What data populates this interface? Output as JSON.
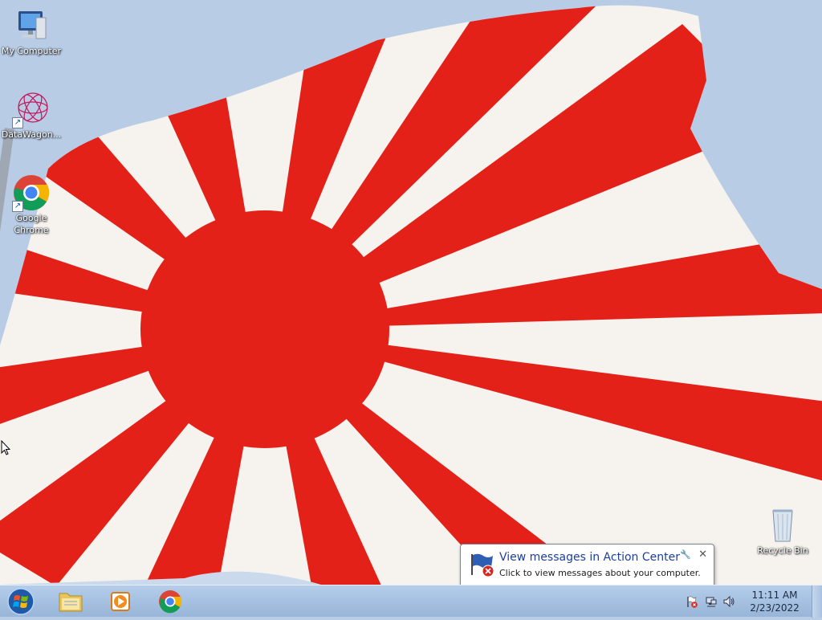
{
  "desktop": {
    "icons": [
      {
        "label": "My Computer",
        "icon": "computer-icon"
      },
      {
        "label": "DataWagon...",
        "icon": "datawagon-icon"
      },
      {
        "label": "Google Chrome",
        "icon": "chrome-icon"
      },
      {
        "label": "Recycle Bin",
        "icon": "recycle-bin-icon"
      }
    ],
    "wallpaper": "rising-sun-flag",
    "colors": {
      "red": "#e32119",
      "white": "#f6f3ef",
      "sky": "#b8cce6"
    }
  },
  "taskbar": {
    "pinned": [
      {
        "name": "Windows Explorer",
        "icon": "folder-icon"
      },
      {
        "name": "Windows Media Player",
        "icon": "media-player-icon"
      },
      {
        "name": "Google Chrome",
        "icon": "chrome-icon"
      }
    ],
    "clock": {
      "time": "11:11 AM",
      "date": "2/23/2022"
    }
  },
  "notification": {
    "title": "View messages in Action Center",
    "message": "Click to view messages about your computer."
  }
}
